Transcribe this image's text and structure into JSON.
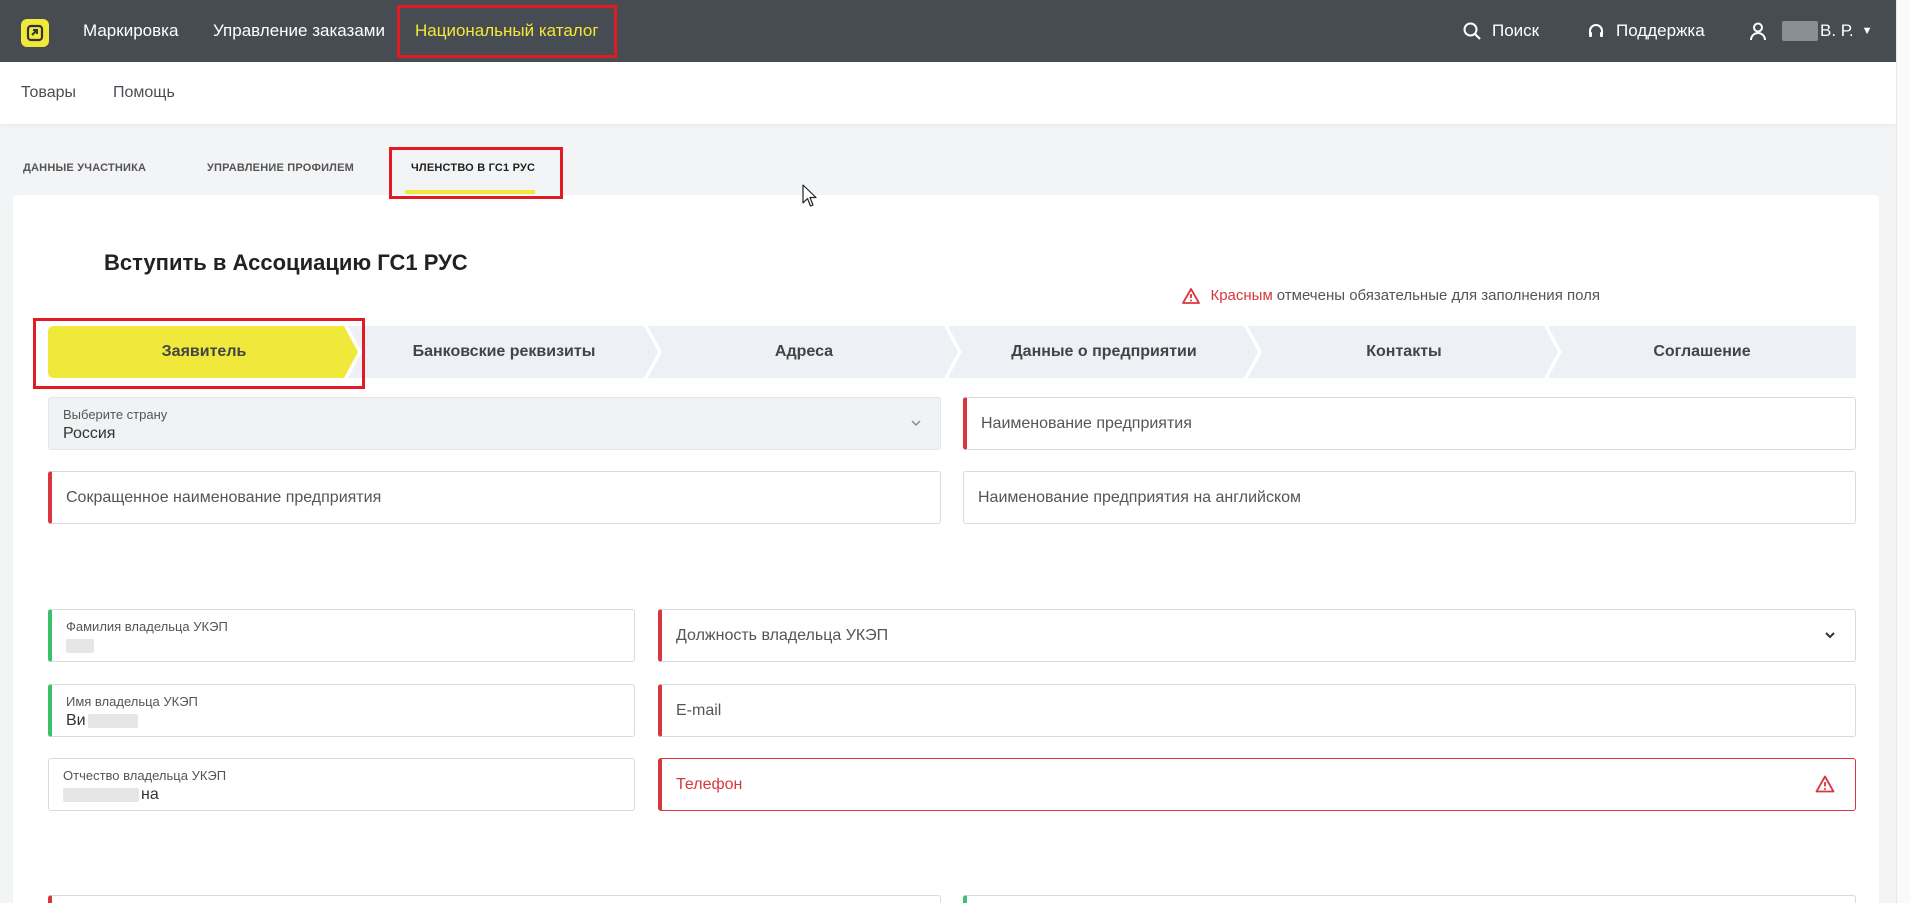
{
  "topnav": {
    "items": [
      {
        "label": "Маркировка"
      },
      {
        "label": "Управление заказами"
      },
      {
        "label": "Национальный каталог"
      }
    ],
    "search_label": "Поиск",
    "support_label": "Поддержка",
    "user_label": "В. Р."
  },
  "subnav": {
    "items": [
      {
        "label": "Товары"
      },
      {
        "label": "Помощь"
      }
    ]
  },
  "profile_tabs": [
    {
      "label": "ДАННЫЕ УЧАСТНИКА"
    },
    {
      "label": "УПРАВЛЕНИЕ ПРОФИЛЕМ"
    },
    {
      "label": "ЧЛЕНСТВО В ГС1 РУС"
    }
  ],
  "page": {
    "title": "Вступить в Ассоциацию ГС1 РУС",
    "required_note_red": "Красным",
    "required_note_rest": "отмечены обязательные для заполнения поля"
  },
  "steps": [
    {
      "label": "Заявитель"
    },
    {
      "label": "Банковские реквизиты"
    },
    {
      "label": "Адреса"
    },
    {
      "label": "Данные о предприятии"
    },
    {
      "label": "Контакты"
    },
    {
      "label": "Соглашение"
    }
  ],
  "form": {
    "country_label": "Выберите страну",
    "country_value": "Россия",
    "company_name_placeholder": "Наименование предприятия",
    "short_name_placeholder": "Сокращенное наименование предприятия",
    "english_name_placeholder": "Наименование предприятия на английском",
    "owner_lastname_label": "Фамилия владельца УКЭП",
    "owner_position_placeholder": "Должность владельца УКЭП",
    "owner_firstname_label": "Имя владельца УКЭП",
    "owner_firstname_value": "Ви",
    "email_placeholder": "E-mail",
    "owner_patronymic_label": "Отчество владельца УКЭП",
    "owner_patronymic_value": "на",
    "phone_placeholder": "Телефон"
  },
  "colors": {
    "topbar": "#474c52",
    "accent_yellow": "#f0e83a",
    "required_red": "#d9363e",
    "valid_green": "#3ac26b",
    "highlight_box": "#e21a24"
  }
}
